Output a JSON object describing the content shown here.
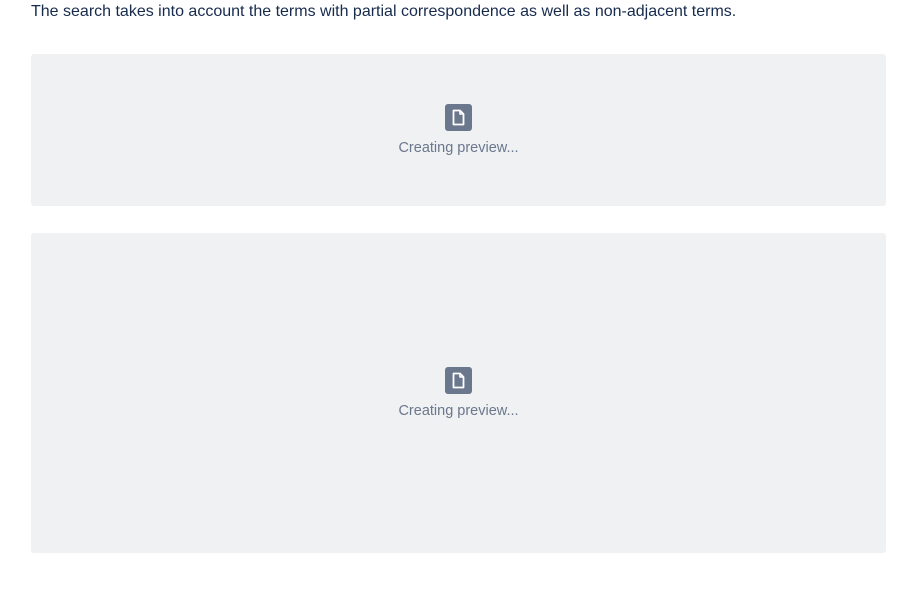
{
  "intro_text": "The search takes into account the terms with partial correspondence as well as non-adjacent terms.",
  "previews": [
    {
      "icon": "file-icon",
      "label": "Creating preview..."
    },
    {
      "icon": "file-icon",
      "label": "Creating preview..."
    }
  ],
  "colors": {
    "text": "#172b4d",
    "muted": "#6b778c",
    "panel_bg": "#f0f1f3",
    "icon_bg": "#6b778c"
  }
}
